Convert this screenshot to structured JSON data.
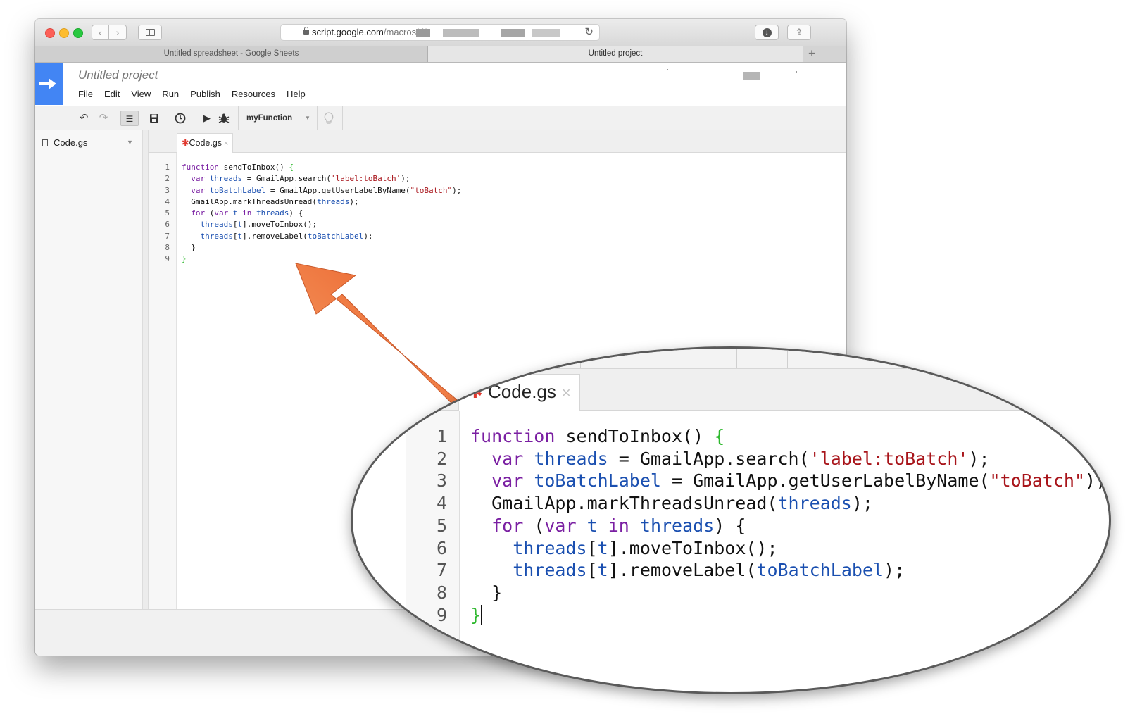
{
  "browser": {
    "url_host": "script.google.com",
    "url_path": "/macros/d/1",
    "tabs": [
      {
        "label": "Untitled spreadsheet - Google Sheets"
      },
      {
        "label": "Untitled project"
      }
    ],
    "new_tab": "+"
  },
  "app": {
    "project_title": "Untitled project",
    "menu": [
      "File",
      "Edit",
      "View",
      "Run",
      "Publish",
      "Resources",
      "Help"
    ],
    "toolbar": {
      "function_select": "myFunction"
    }
  },
  "files": {
    "items": [
      {
        "label": "Code.gs"
      }
    ]
  },
  "editor": {
    "tab_label": "Code.gs",
    "tab_modified_mark": "✱",
    "tab_close": "×",
    "line_numbers": [
      "1",
      "2",
      "3",
      "4",
      "5",
      "6",
      "7",
      "8",
      "9"
    ],
    "lines": [
      [
        {
          "t": "function",
          "c": "kw"
        },
        {
          "t": " sendToInbox() ",
          "c": "tx"
        },
        {
          "t": "{",
          "c": "br"
        }
      ],
      [
        {
          "t": "  ",
          "c": "tx"
        },
        {
          "t": "var",
          "c": "kw"
        },
        {
          "t": " ",
          "c": "tx"
        },
        {
          "t": "threads",
          "c": "vn"
        },
        {
          "t": " = GmailApp.search(",
          "c": "tx"
        },
        {
          "t": "'label:toBatch'",
          "c": "st"
        },
        {
          "t": ");",
          "c": "tx"
        }
      ],
      [
        {
          "t": "  ",
          "c": "tx"
        },
        {
          "t": "var",
          "c": "kw"
        },
        {
          "t": " ",
          "c": "tx"
        },
        {
          "t": "toBatchLabel",
          "c": "vn"
        },
        {
          "t": " = GmailApp.getUserLabelByName(",
          "c": "tx"
        },
        {
          "t": "\"toBatch\"",
          "c": "st"
        },
        {
          "t": ");",
          "c": "tx"
        }
      ],
      [
        {
          "t": "  GmailApp.markThreadsUnread(",
          "c": "tx"
        },
        {
          "t": "threads",
          "c": "vn"
        },
        {
          "t": ");",
          "c": "tx"
        }
      ],
      [
        {
          "t": "  ",
          "c": "tx"
        },
        {
          "t": "for",
          "c": "kw"
        },
        {
          "t": " (",
          "c": "tx"
        },
        {
          "t": "var",
          "c": "kw"
        },
        {
          "t": " ",
          "c": "tx"
        },
        {
          "t": "t",
          "c": "vn"
        },
        {
          "t": " ",
          "c": "tx"
        },
        {
          "t": "in",
          "c": "kw"
        },
        {
          "t": " ",
          "c": "tx"
        },
        {
          "t": "threads",
          "c": "vn"
        },
        {
          "t": ") {",
          "c": "tx"
        }
      ],
      [
        {
          "t": "    ",
          "c": "tx"
        },
        {
          "t": "threads",
          "c": "vn"
        },
        {
          "t": "[",
          "c": "tx"
        },
        {
          "t": "t",
          "c": "vn"
        },
        {
          "t": "].moveToInbox();",
          "c": "tx"
        }
      ],
      [
        {
          "t": "    ",
          "c": "tx"
        },
        {
          "t": "threads",
          "c": "vn"
        },
        {
          "t": "[",
          "c": "tx"
        },
        {
          "t": "t",
          "c": "vn"
        },
        {
          "t": "].removeLabel(",
          "c": "tx"
        },
        {
          "t": "toBatchLabel",
          "c": "vn"
        },
        {
          "t": ");",
          "c": "tx"
        }
      ],
      [
        {
          "t": "  }",
          "c": "tx"
        }
      ],
      [
        {
          "t": "}",
          "c": "br"
        }
      ]
    ]
  },
  "colors": {
    "keyword": "#7a1fa2",
    "variable": "#1a4fb0",
    "string": "#a8141a",
    "brace": "#2eb82e",
    "arrow": "#f26a2e",
    "logo": "#4285f4"
  },
  "icons": [
    "close-window",
    "minimize-window",
    "zoom-window",
    "back-icon",
    "forward-icon",
    "sidebar-icon",
    "lock-icon",
    "reload-icon",
    "download-icon",
    "share-icon",
    "undo-icon",
    "redo-icon",
    "indent-icon",
    "save-icon",
    "trigger-clock-icon",
    "run-icon",
    "debug-bug-icon",
    "lightbulb-icon",
    "file-icon",
    "callout-arrow"
  ]
}
